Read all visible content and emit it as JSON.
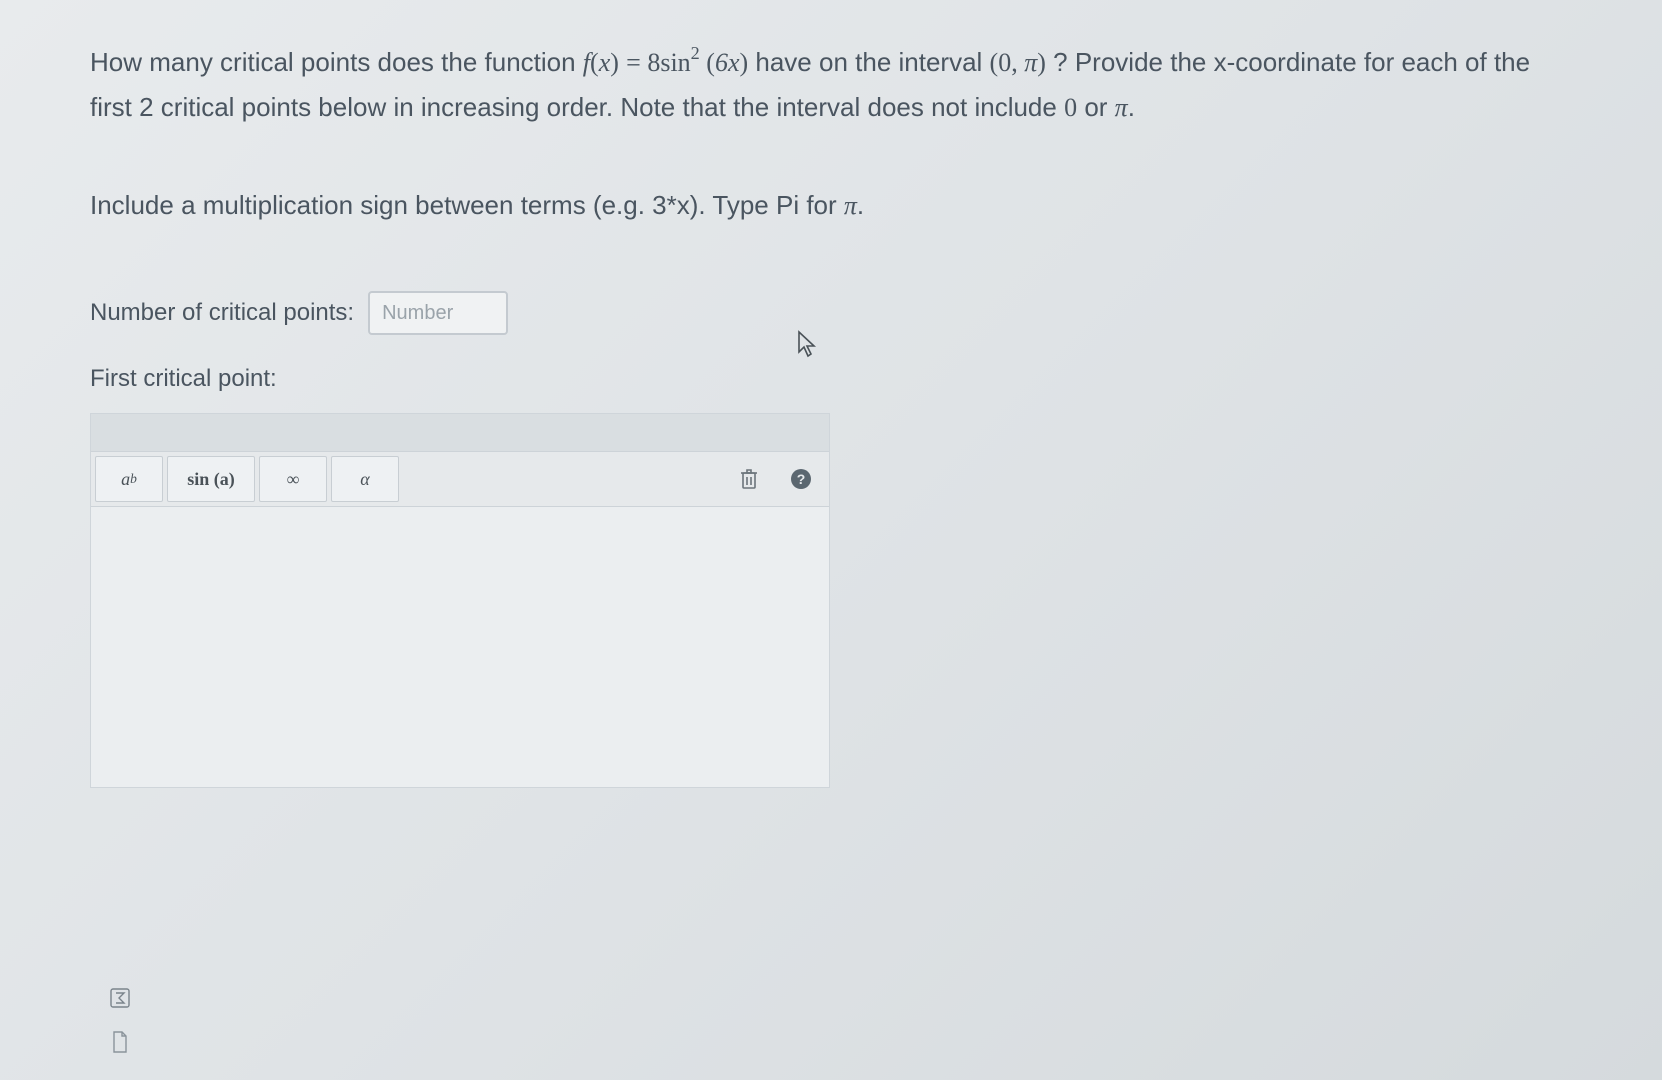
{
  "question": {
    "prefix": "How many critical points does the function ",
    "func_expr_f": "f",
    "func_expr_paren_open": "(",
    "func_expr_x": "x",
    "func_expr_paren_close": ")",
    "func_expr_eq": " = ",
    "func_expr_coef": "8sin",
    "func_expr_exp": "2",
    "func_expr_arg_open": " (",
    "func_expr_arg": "6x",
    "func_expr_arg_close": ")",
    "middle": " have on the interval ",
    "interval_open": "(",
    "interval_zero": "0",
    "interval_comma": ", ",
    "interval_pi": "π",
    "interval_close": ")",
    "suffix1": "? Provide the x-coordinate for each of the first 2 critical points below in increasing order. Note that the interval does not include ",
    "zero_text": "0",
    "or_text": " or ",
    "pi_text": "π",
    "period": "."
  },
  "instruction": {
    "text_prefix": "Include a multiplication sign between terms (e.g. 3*x). Type Pi for ",
    "pi": "π",
    "period": "."
  },
  "labels": {
    "num_critical": "Number of critical points:",
    "first_critical": "First critical point:"
  },
  "inputs": {
    "number_placeholder": "Number"
  },
  "toolbar": {
    "btn_power_base": "a",
    "btn_power_exp": "b",
    "btn_sin": "sin (a)",
    "btn_infinity": "∞",
    "btn_alpha": "α"
  }
}
